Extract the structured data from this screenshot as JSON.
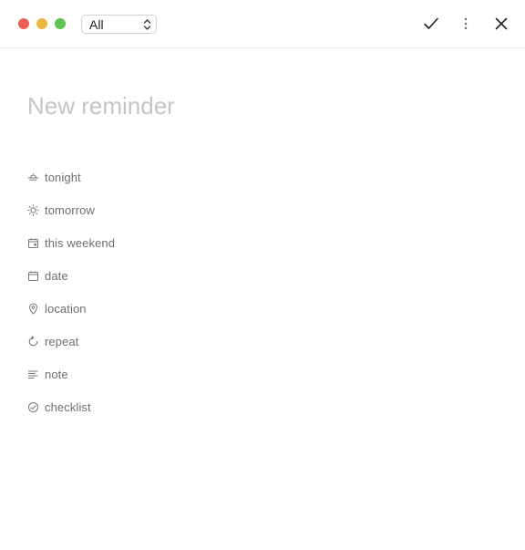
{
  "window": {
    "controls": {
      "close_color": "#ec5f57",
      "minimize_color": "#e8b93e",
      "maximize_color": "#5fc453"
    }
  },
  "toolbar": {
    "list_select": {
      "selected": "All",
      "icon": "updown-chevron-icon"
    },
    "actions": [
      {
        "name": "confirm",
        "icon": "checkmark-icon"
      },
      {
        "name": "more",
        "icon": "vertical-ellipsis-icon"
      },
      {
        "name": "close",
        "icon": "close-x-icon"
      }
    ]
  },
  "reminder": {
    "title_placeholder": "New reminder",
    "title_value": ""
  },
  "options": [
    {
      "label": "tonight",
      "icon": "sunset-icon"
    },
    {
      "label": "tomorrow",
      "icon": "sun-icon"
    },
    {
      "label": "this weekend",
      "icon": "calendar-weekend-icon"
    },
    {
      "label": "date",
      "icon": "calendar-icon"
    },
    {
      "label": "location",
      "icon": "location-pin-icon"
    },
    {
      "label": "repeat",
      "icon": "repeat-icon"
    },
    {
      "label": "note",
      "icon": "note-lines-icon"
    },
    {
      "label": "checklist",
      "icon": "check-circle-icon"
    }
  ],
  "colors": {
    "text_muted": "#6f6f6f",
    "placeholder": "#c5c5c5",
    "divider": "#ececec"
  }
}
